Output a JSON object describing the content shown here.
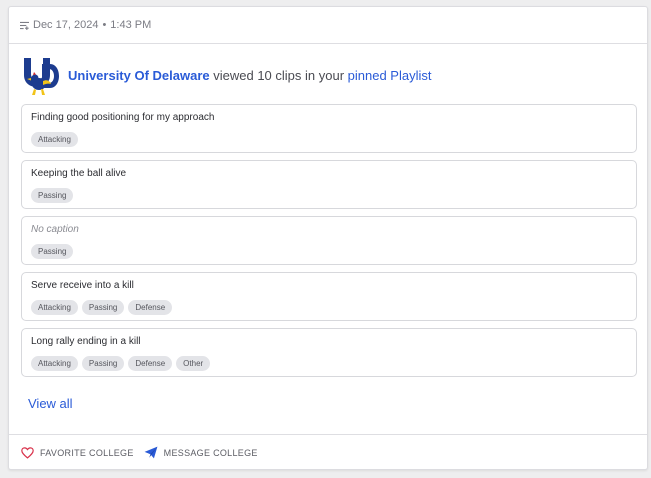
{
  "header": {
    "date": "Dec 17, 2024",
    "separator": "•",
    "time": "1:43 PM"
  },
  "activity": {
    "college": "University Of Delaware",
    "middle_text": " viewed 10 clips in your ",
    "link_text": "pinned Playlist"
  },
  "clips": [
    {
      "caption": "Finding good positioning for my approach",
      "tags": [
        "Attacking"
      ]
    },
    {
      "caption": "Keeping the ball alive",
      "tags": [
        "Passing"
      ]
    },
    {
      "caption": "No caption",
      "tags": [
        "Passing"
      ]
    },
    {
      "caption": "Serve receive into a kill",
      "tags": [
        "Attacking",
        "Passing",
        "Defense"
      ]
    },
    {
      "caption": "Long rally ending in a kill",
      "tags": [
        "Attacking",
        "Passing",
        "Defense",
        "Other"
      ]
    }
  ],
  "view_all": "View all",
  "footer": {
    "favorite_label": "FAVORITE COLLEGE",
    "message_label": "MESSAGE COLLEGE"
  },
  "colors": {
    "accent": "#2a5bd7",
    "favorite_icon": "#d9314a",
    "tag_bg": "#e3e4e8"
  },
  "icons": {
    "header": "filter-lines-icon",
    "favorite": "heart-outline-icon",
    "message": "paper-plane-icon",
    "logo": "university-of-delaware-blue-hen-logo"
  }
}
